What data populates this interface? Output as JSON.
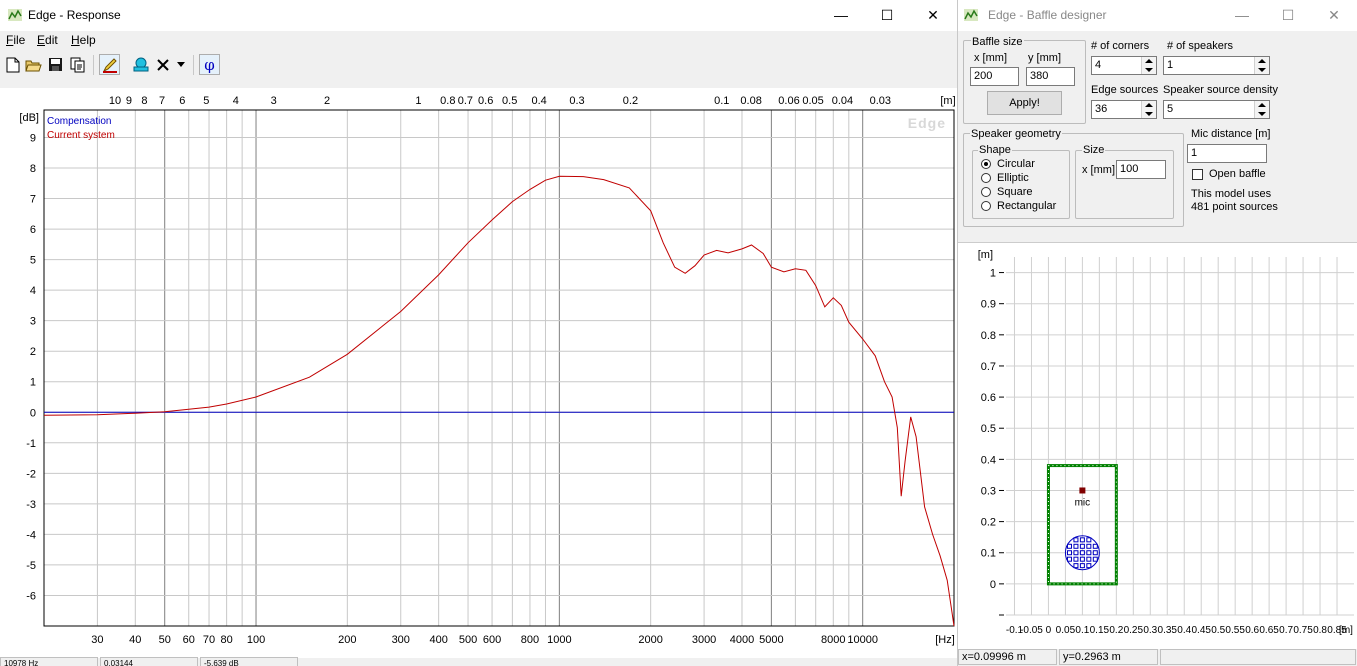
{
  "response_window": {
    "title": "Edge - Response",
    "menu": [
      "File",
      "Edit",
      "Help"
    ],
    "toolbar_icons": [
      "new-file-icon",
      "open-folder-icon",
      "save-icon",
      "copy-icon",
      "pencil-icon",
      "stamp-icon",
      "delete-x-icon",
      "dropdown-arrow-icon",
      "phase-phi-icon"
    ],
    "phase_symbol": "φ",
    "window_controls": {
      "minimize": "—",
      "maximize": "☐",
      "close": "✕"
    },
    "plot": {
      "watermark": "Edge",
      "y_unit": "[dB]",
      "x_unit": "[Hz]",
      "top_unit": "[m]",
      "legend": [
        "Compensation",
        "Current system"
      ],
      "y_ticks": [
        "9",
        "8",
        "7",
        "6",
        "5",
        "4",
        "3",
        "2",
        "1",
        "0",
        "-1",
        "-2",
        "-3",
        "-4",
        "-5",
        "-6"
      ],
      "x_ticks": [
        "30",
        "40",
        "50",
        "60",
        "70",
        "80",
        "100",
        "200",
        "300",
        "400",
        "500",
        "600",
        "800",
        "1000",
        "2000",
        "3000",
        "4000",
        "5000",
        "8000",
        "10000"
      ],
      "top_ticks": [
        "10",
        "9",
        "8",
        "7",
        "6",
        "5",
        "4",
        "3",
        "2",
        "1",
        "0.8",
        "0.7",
        "0.6",
        "0.5",
        "0.4",
        "0.3",
        "0.2",
        "0.1",
        "0.08",
        "0.06",
        "0.05",
        "0.04",
        "0.03"
      ]
    },
    "colors": {
      "compensation": "#0000c0",
      "current": "#c00000",
      "grid": "#c8c8c8",
      "grid_major": "#808080"
    },
    "status": [
      "10978 Hz",
      "0.03144",
      "-5.639 dB"
    ]
  },
  "baffle_window": {
    "title": "Edge - Baffle designer",
    "window_controls": {
      "minimize": "—",
      "maximize": "☐",
      "close": "✕"
    },
    "baffle_size": {
      "label": "Baffle size",
      "x_label": "x [mm]",
      "y_label": "y [mm]",
      "x_value": "200",
      "y_value": "380",
      "apply": "Apply!"
    },
    "corners": {
      "label": "# of corners",
      "value": "4"
    },
    "speakers": {
      "label": "# of speakers",
      "value": "1"
    },
    "edge_sources": {
      "label": "Edge sources",
      "value": "36"
    },
    "speaker_density": {
      "label": "Speaker source density",
      "value": "5"
    },
    "speaker_geometry": {
      "label": "Speaker geometry",
      "shape_label": "Shape",
      "shapes": [
        "Circular",
        "Elliptic",
        "Square",
        "Rectangular"
      ],
      "selected": "Circular",
      "size_label": "Size",
      "size_x_label": "x [mm]",
      "size_x_value": "100"
    },
    "mic_distance": {
      "label": "Mic distance [m]",
      "value": "1"
    },
    "open_baffle": {
      "label": "Open baffle",
      "checked": false
    },
    "model_info": [
      "This model uses",
      "481 point sources"
    ],
    "geometry_plot": {
      "unit_y": "[m]",
      "unit_x": "[m]",
      "y_ticks": [
        "1",
        "0.9",
        "0.8",
        "0.7",
        "0.6",
        "0.5",
        "0.4",
        "0.3",
        "0.2",
        "0.1",
        "0"
      ],
      "x_ticks": [
        "-0.1",
        "-0.05",
        "0",
        "0.05",
        "0.1",
        "0.15",
        "0.2",
        "0.25",
        "0.3",
        "0.35",
        "0.4",
        "0.45",
        "0.5",
        "0.55",
        "0.6",
        "0.65",
        "0.7",
        "0.75",
        "0.8",
        "0.85"
      ],
      "mic_label": "mic",
      "colors": {
        "baffle": "#008000",
        "speaker": "#0000c0",
        "mic": "#800000"
      }
    },
    "status": [
      "x=0.09996 m",
      "y=0.2963 m"
    ]
  }
}
